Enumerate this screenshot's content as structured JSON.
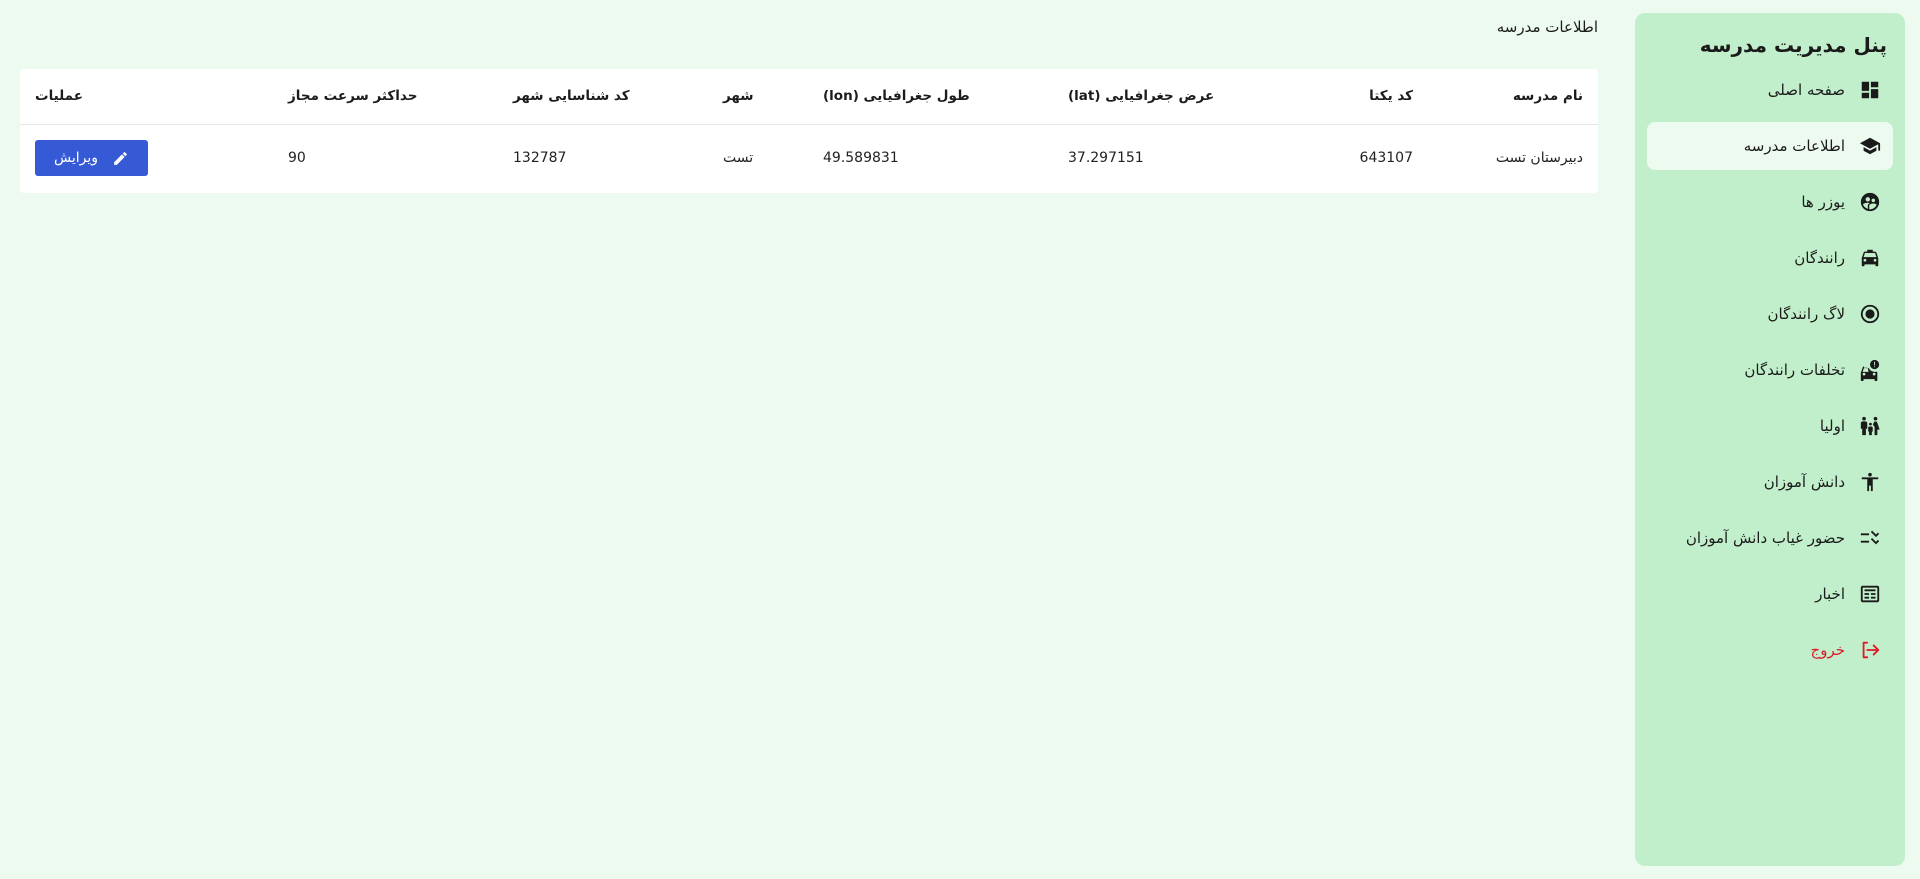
{
  "sidebar": {
    "title": "پنل مدیریت مدرسه",
    "items": [
      {
        "label": "صفحه اصلی",
        "icon": "dashboard-icon"
      },
      {
        "label": "اطلاعات مدرسه",
        "icon": "school-icon",
        "active": true
      },
      {
        "label": "یوزر ها",
        "icon": "users-icon"
      },
      {
        "label": "رانندگان",
        "icon": "taxi-icon"
      },
      {
        "label": "لاگ رانندگان",
        "icon": "radio-button-icon"
      },
      {
        "label": "تخلفات رانندگان",
        "icon": "car-warning-icon"
      },
      {
        "label": "اولیا",
        "icon": "family-icon"
      },
      {
        "label": "دانش آموزان",
        "icon": "accessibility-icon"
      },
      {
        "label": "حضور غیاب دانش آموزان",
        "icon": "checklist-icon"
      },
      {
        "label": "اخبار",
        "icon": "newspaper-icon"
      },
      {
        "label": "خروج",
        "icon": "logout-icon",
        "color": "#e01a2b"
      }
    ]
  },
  "page": {
    "title": "اطلاعات مدرسه"
  },
  "table": {
    "headers": {
      "name": "نام مدرسه",
      "code": "کد یکتا",
      "lat": "عرض جغرافیایی (lat)",
      "lon": "طول جغرافیایی (lon)",
      "city": "شهر",
      "city_code": "کد شناسایی شهر",
      "speed": "حداکثر سرعت مجاز",
      "actions": "عملیات"
    },
    "rows": [
      {
        "name": "دبیرستان تست",
        "code": "643107",
        "lat": "37.297151",
        "lon": "49.589831",
        "city": "تست",
        "city_code": "132787",
        "speed": "90",
        "edit_label": "ویرایش"
      }
    ]
  },
  "colors": {
    "background": "#edfaef",
    "sidebar": "#c2efcb",
    "primary_button": "#3659d6",
    "logout": "#e01a2b"
  }
}
